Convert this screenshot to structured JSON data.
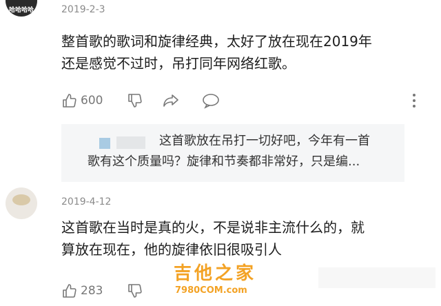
{
  "comments": [
    {
      "avatar_text": "哈哈哈哈",
      "date": "2019-2-3",
      "text_line1": "整首歌的歌词和旋律经典，太好了放在现在2019年",
      "text_line2": "还是感觉不过时，吊打同年网络红歌。",
      "like_count": "600"
    },
    {
      "date": "2019-4-12",
      "text_line1": "这首歌在当时是真的火，不是说非主流什么的，就",
      "text_line2": "算放在现在，他的旋律依旧很吸引人",
      "like_count": "283"
    }
  ],
  "reply": {
    "line1": "这首歌放在吊打一切好吧，今年有一首",
    "line2": "歌有这个质量吗？旋律和节奏都非常好，只是编..."
  },
  "watermark": {
    "title": "吉他之家",
    "url": "7980COM.com"
  },
  "icons": [
    "thumbs-up-icon",
    "thumbs-down-icon",
    "share-icon",
    "comment-icon",
    "more-icon"
  ],
  "colors": {
    "watermark": "#f3a224",
    "date": "#8a8a8a",
    "reply_bg": "#f5f6f7"
  }
}
